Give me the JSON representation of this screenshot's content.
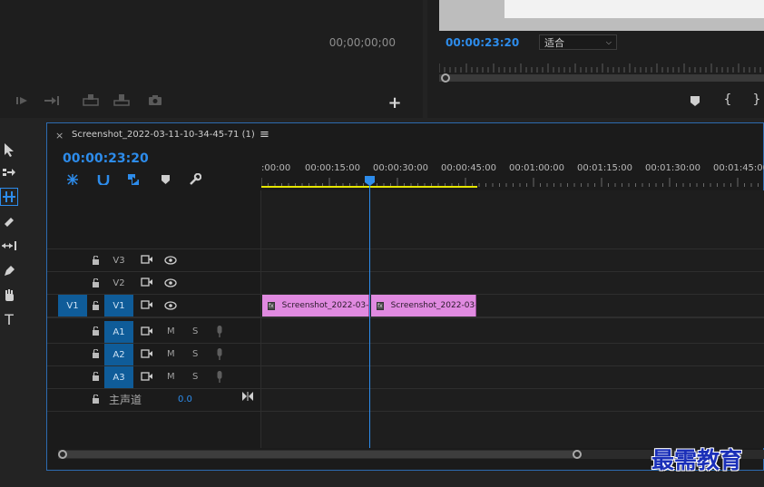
{
  "source_monitor": {
    "timecode": "00;00;00;00"
  },
  "program_monitor": {
    "timecode": "00:00:23:20",
    "zoom_select": "适合"
  },
  "sequence": {
    "tab_title": "Screenshot_2022-03-11-10-34-45-71 (1)",
    "close": "×",
    "menu": "≡",
    "timecode": "00:00:23:20"
  },
  "ruler": {
    "labels": [
      ":00:00",
      "00:00:15:00",
      "00:00:30:00",
      "00:00:45:00",
      "00:01:00:00",
      "00:01:15:00",
      "00:01:30:00",
      "00:01:45:00"
    ]
  },
  "tracks": {
    "video": [
      {
        "source": "",
        "name": "V3",
        "selected": false
      },
      {
        "source": "",
        "name": "V2",
        "selected": false
      },
      {
        "source": "V1",
        "name": "V1",
        "selected": true
      }
    ],
    "audio": [
      {
        "name": "A1",
        "m": "M",
        "s": "S"
      },
      {
        "name": "A2",
        "m": "M",
        "s": "S"
      },
      {
        "name": "A3",
        "m": "M",
        "s": "S"
      }
    ],
    "master": {
      "label": "主声道",
      "value": "0.0"
    }
  },
  "clips": [
    {
      "label": "Screenshot_2022-03-"
    },
    {
      "label": "Screenshot_2022-03-"
    }
  ],
  "watermark": "最需教育",
  "colors": {
    "accent": "#2d8ceb",
    "clip": "#e08ae0",
    "work_area": "#e6e600"
  }
}
